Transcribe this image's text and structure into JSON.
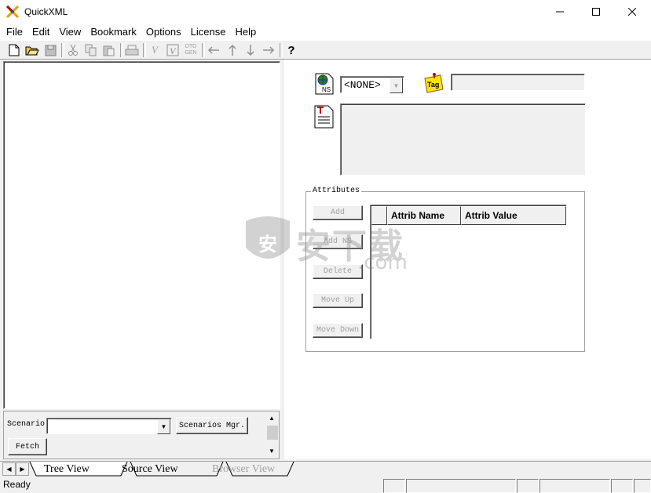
{
  "window": {
    "title": "QuickXML",
    "minimize": "—",
    "maximize": "☐",
    "close": "✕"
  },
  "menu": [
    "File",
    "Edit",
    "View",
    "Bookmark",
    "Options",
    "License",
    "Help"
  ],
  "toolbar": {
    "icons": [
      "new-file-icon",
      "open-folder-icon",
      "save-icon",
      "cut-icon",
      "copy-icon",
      "paste-icon",
      "print-icon",
      "validate-icon",
      "validate-dtd-icon",
      "dtd-gen-icon",
      "arrow-left-icon",
      "arrow-up-icon",
      "arrow-down-icon",
      "arrow-right-icon",
      "help-icon"
    ],
    "dtd_gen_label_top": "DTD",
    "dtd_gen_label_bottom": "GEN",
    "help_glyph": "?"
  },
  "scenario": {
    "label": "Scenario",
    "combo_value": "",
    "mgr_button": "Scenarios Mgr.",
    "fetch_button": "Fetch"
  },
  "detail": {
    "ns_icon_label": "NS",
    "ns_select_value": "<NONE>",
    "tag_icon_label": "Tag",
    "tag_value": "",
    "text_value": ""
  },
  "attributes": {
    "legend": "Attributes",
    "buttons": {
      "add": "Add",
      "add_ns": "Add NS",
      "delete": "Delete",
      "move_up": "Move Up",
      "move_down": "Move Down"
    },
    "columns": [
      "Attrib Name",
      "Attrib Value"
    ]
  },
  "tabs": [
    "Tree View",
    "Source View",
    "Browser View"
  ],
  "status": {
    "text": "Ready"
  },
  "watermark": {
    "text": "安下载",
    "subtext": ".com"
  },
  "colors": {
    "window_bg": "#f0f0f0",
    "disabled_text": "#a0a0a0",
    "tag_yellow": "#ffe600"
  }
}
